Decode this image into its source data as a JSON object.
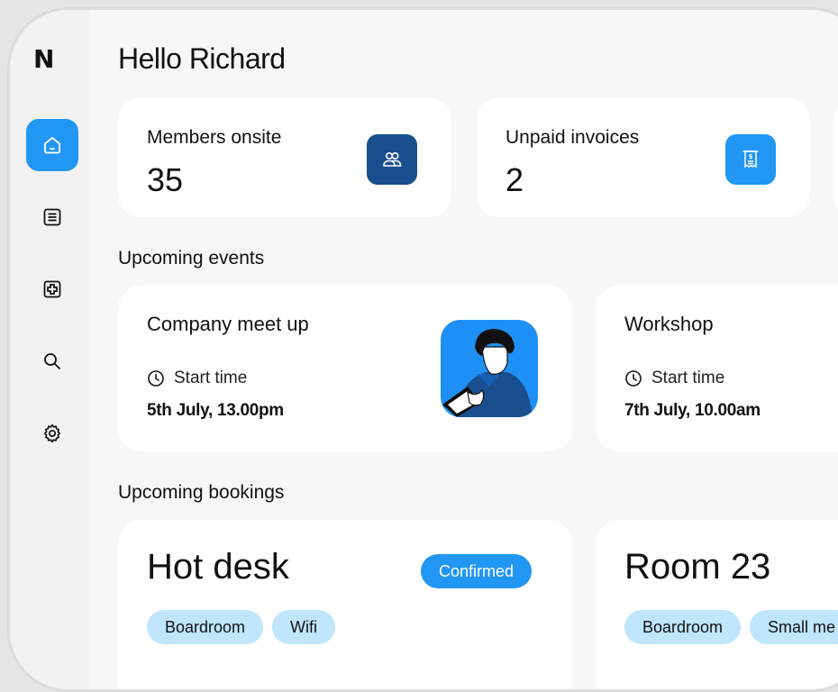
{
  "app": {
    "logo": "N"
  },
  "sidebar": {
    "items": [
      {
        "icon": "home-icon",
        "active": true
      },
      {
        "icon": "list-icon",
        "active": false
      },
      {
        "icon": "plus-square-icon",
        "active": false
      },
      {
        "icon": "search-icon",
        "active": false
      },
      {
        "icon": "gear-icon",
        "active": false
      }
    ]
  },
  "header": {
    "greeting": "Hello Richard"
  },
  "stats": [
    {
      "label": "Members onsite",
      "value": "35",
      "icon": "users-icon",
      "icon_bg": "#1a4f8f"
    },
    {
      "label": "Unpaid invoices",
      "value": "2",
      "icon": "receipt-icon",
      "icon_bg": "#2196f3"
    }
  ],
  "events": {
    "title": "Upcoming events",
    "items": [
      {
        "name": "Company meet up",
        "start_label": "Start time",
        "date": "5th July, 13.00pm"
      },
      {
        "name": "Workshop",
        "start_label": "Start time",
        "date": "7th July, 10.00am"
      }
    ]
  },
  "bookings": {
    "title": "Upcoming bookings",
    "items": [
      {
        "name": "Hot desk",
        "status": "Confirmed",
        "tags": [
          "Boardroom",
          "Wifi"
        ]
      },
      {
        "name": "Room 23",
        "tags": [
          "Boardroom",
          "Small me"
        ]
      }
    ]
  },
  "colors": {
    "accent": "#2196f3",
    "tag_bg": "#bfe6fc",
    "dark_blue": "#1a4f8f"
  }
}
